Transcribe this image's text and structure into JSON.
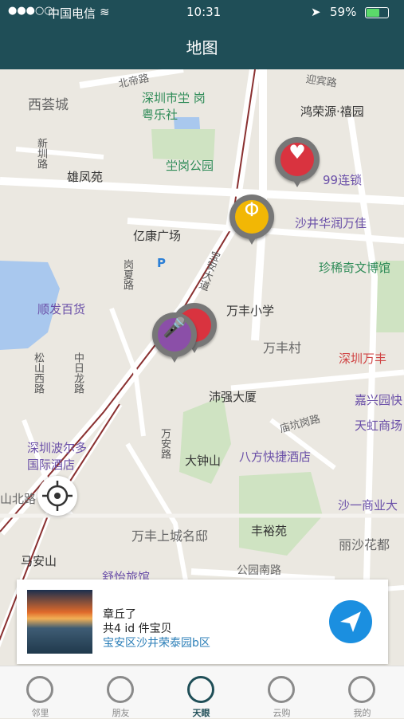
{
  "status": {
    "carrier": "中国电信",
    "time": "10:31",
    "battery": "59%"
  },
  "nav": {
    "title": "地图"
  },
  "map_labels": {
    "xihuicheng": "西荟城",
    "yingbin": "迎宾路",
    "beidi": "北帝路",
    "shenzhen_shi_gang": "深圳市坣\n岗粤乐社",
    "hongrongyuan": "鸿荣源·禧园",
    "xingang": "新圳路",
    "xiongfengyuan": "雄凤苑",
    "shigang_park": "坣岗公园",
    "chain99": "99连锁",
    "shajing_huarun": "沙井华润万佳",
    "yikang": "亿康广场",
    "gangsha": "岗夏路",
    "baoan_road": "宝安大道",
    "zhenxi": "珍稀奇文博馆",
    "shunfa": "顺发百货",
    "wanfeng_school": "万丰小学",
    "wanfeng_village": "万丰村",
    "shenzhen_wanfeng": "深圳万丰",
    "songshan": "松山西路",
    "zhongri": "中日龙路",
    "peiqiang": "沛强大厦",
    "jiaxing": "嘉兴园快",
    "miaokeng": "庙坑岗路",
    "wanan": "万安路",
    "boer": "深圳波尔多\n国际酒店",
    "dazhong": "大钟山",
    "bafang": "八方快捷酒店",
    "tianhong": "天虹商场",
    "shanbei": "山北路",
    "shayi": "沙一商业大",
    "wanfeng_shangcheng": "万丰上城名邸",
    "fengyu": "丰裕苑",
    "lisha": "丽沙花都",
    "maanshan": "马安山",
    "gongyuan_south": "公园南路",
    "shuyi": "舒怡旅馆"
  },
  "pins": [
    {
      "name": "health",
      "color": "#d9333f",
      "icon": "heart-icon"
    },
    {
      "name": "food",
      "color": "#f2b705",
      "icon": "coin-icon"
    },
    {
      "name": "music",
      "color": "#8b4fa8",
      "icon": "microphone-icon"
    }
  ],
  "card": {
    "line1": "章丘了",
    "line2": "共4 id 件宝贝",
    "line3": "宝安区沙井荣泰园b区"
  },
  "tabs": [
    {
      "label": "邻里"
    },
    {
      "label": "朋友"
    },
    {
      "label": "天眼"
    },
    {
      "label": "云购"
    },
    {
      "label": "我的"
    }
  ]
}
